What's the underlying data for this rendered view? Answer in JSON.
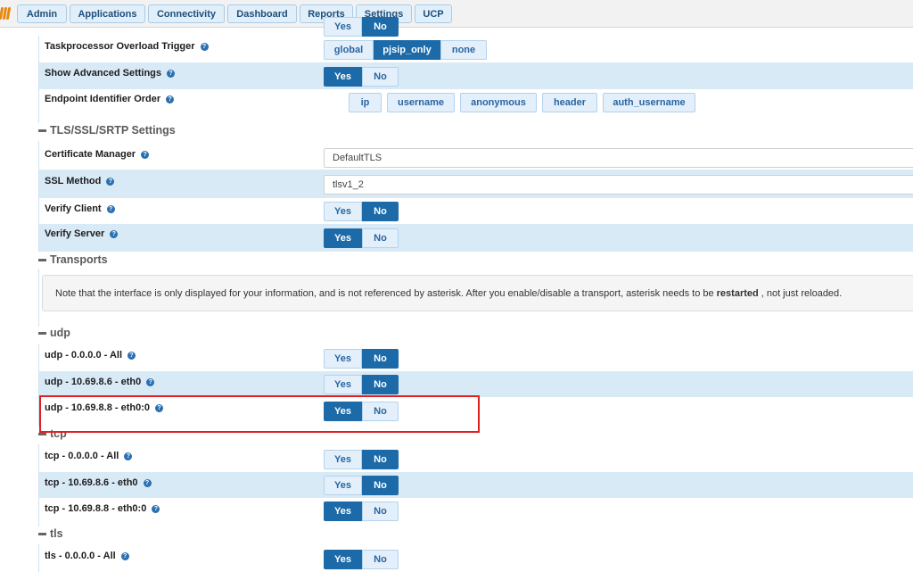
{
  "nav": [
    "Admin",
    "Applications",
    "Connectivity",
    "Dashboard",
    "Reports",
    "Settings",
    "UCP"
  ],
  "top_partial": {
    "yes": "Yes",
    "no": "No"
  },
  "general": {
    "taskprocessor": {
      "label": "Taskprocessor Overload Trigger",
      "options": [
        "global",
        "pjsip_only",
        "none"
      ],
      "selected": "pjsip_only"
    },
    "show_advanced": {
      "label": "Show Advanced Settings",
      "selected": "Yes"
    },
    "endpoint_identifier": {
      "label": "Endpoint Identifier Order",
      "chips": [
        "ip",
        "username",
        "anonymous",
        "header",
        "auth_username"
      ]
    }
  },
  "tls_section": {
    "title": "TLS/SSL/SRTP Settings",
    "certificate_manager": {
      "label": "Certificate Manager",
      "value": "DefaultTLS"
    },
    "ssl_method": {
      "label": "SSL Method",
      "value": "tlsv1_2"
    },
    "verify_client": {
      "label": "Verify Client",
      "selected": "No"
    },
    "verify_server": {
      "label": "Verify Server",
      "selected": "Yes"
    }
  },
  "transports": {
    "title": "Transports",
    "notice_before": "Note that the interface is only displayed for your information, and is not referenced by asterisk. After you enable/disable a transport, asterisk needs to be",
    "notice_bold": "restarted",
    "notice_after": ", not just reloaded."
  },
  "yes_label": "Yes",
  "no_label": "No",
  "udp": {
    "title": "udp",
    "rows": [
      {
        "label": "udp - 0.0.0.0 - All",
        "selected": "No"
      },
      {
        "label": "udp - 10.69.8.6 - eth0",
        "selected": "No"
      },
      {
        "label": "udp - 10.69.8.8 - eth0:0",
        "selected": "Yes"
      }
    ]
  },
  "tcp": {
    "title": "tcp",
    "rows": [
      {
        "label": "tcp - 0.0.0.0 - All",
        "selected": "No"
      },
      {
        "label": "tcp - 10.69.8.6 - eth0",
        "selected": "No"
      },
      {
        "label": "tcp - 10.69.8.8 - eth0:0",
        "selected": "Yes"
      }
    ]
  },
  "tls": {
    "title": "tls",
    "rows": [
      {
        "label": "tls - 0.0.0.0 - All",
        "selected": "Yes"
      }
    ]
  },
  "colors": {
    "accent": "#1c6aa8",
    "highlight": "#e02020",
    "row_alt": "#d9eaf7"
  }
}
